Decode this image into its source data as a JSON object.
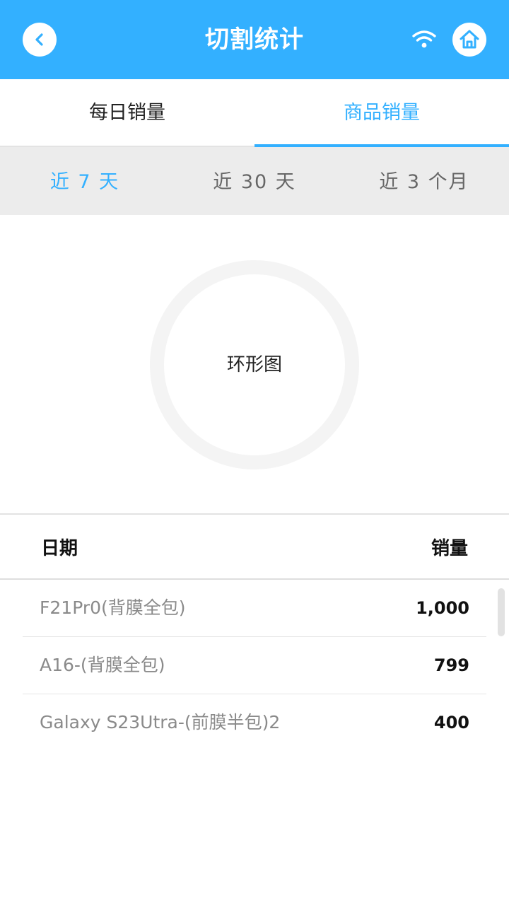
{
  "header": {
    "title": "切割统计",
    "back_icon": "chevron-left-icon",
    "wifi_icon": "wifi-icon",
    "home_icon": "home-icon",
    "accent_color": "#33b0ff"
  },
  "tabs": [
    {
      "label": "每日销量",
      "active": false
    },
    {
      "label": "商品销量",
      "active": true
    }
  ],
  "periods": [
    {
      "label": "近 7 天",
      "active": true
    },
    {
      "label": "近 30 天",
      "active": false
    },
    {
      "label": "近 3 个月",
      "active": false
    }
  ],
  "chart": {
    "label": "环形图"
  },
  "table": {
    "col_date": "日期",
    "col_sales": "销量",
    "rows": [
      {
        "name": "F21Pr0(背膜全包)",
        "value": "1,000"
      },
      {
        "name": "A16-(背膜全包)",
        "value": "799"
      },
      {
        "name": "Galaxy S23Utra-(前膜半包)2",
        "value": "400"
      }
    ]
  }
}
